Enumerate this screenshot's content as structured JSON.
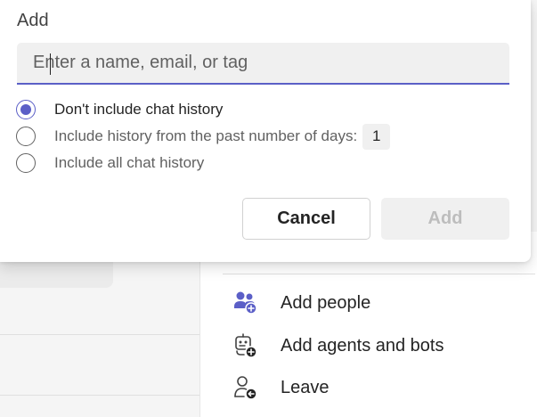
{
  "dialog": {
    "title": "Add",
    "search": {
      "value": "",
      "placeholder": "Enter a name, email, or tag"
    },
    "history_options": [
      {
        "label": "Don't include chat history",
        "selected": true
      },
      {
        "label": "Include history from the past number of days:",
        "selected": false,
        "days_value": "1"
      },
      {
        "label": "Include all chat history",
        "selected": false
      }
    ],
    "buttons": {
      "cancel": "Cancel",
      "add": "Add",
      "add_enabled": false
    }
  },
  "menu": {
    "items": [
      {
        "label": "Add people",
        "icon": "add-people-icon"
      },
      {
        "label": "Add agents and bots",
        "icon": "add-bot-icon"
      },
      {
        "label": "Leave",
        "icon": "leave-icon"
      }
    ]
  },
  "colors": {
    "accent": "#5b5fc7",
    "text": "#242424",
    "muted_text": "#616161",
    "disabled_text": "#bdbdbd"
  }
}
